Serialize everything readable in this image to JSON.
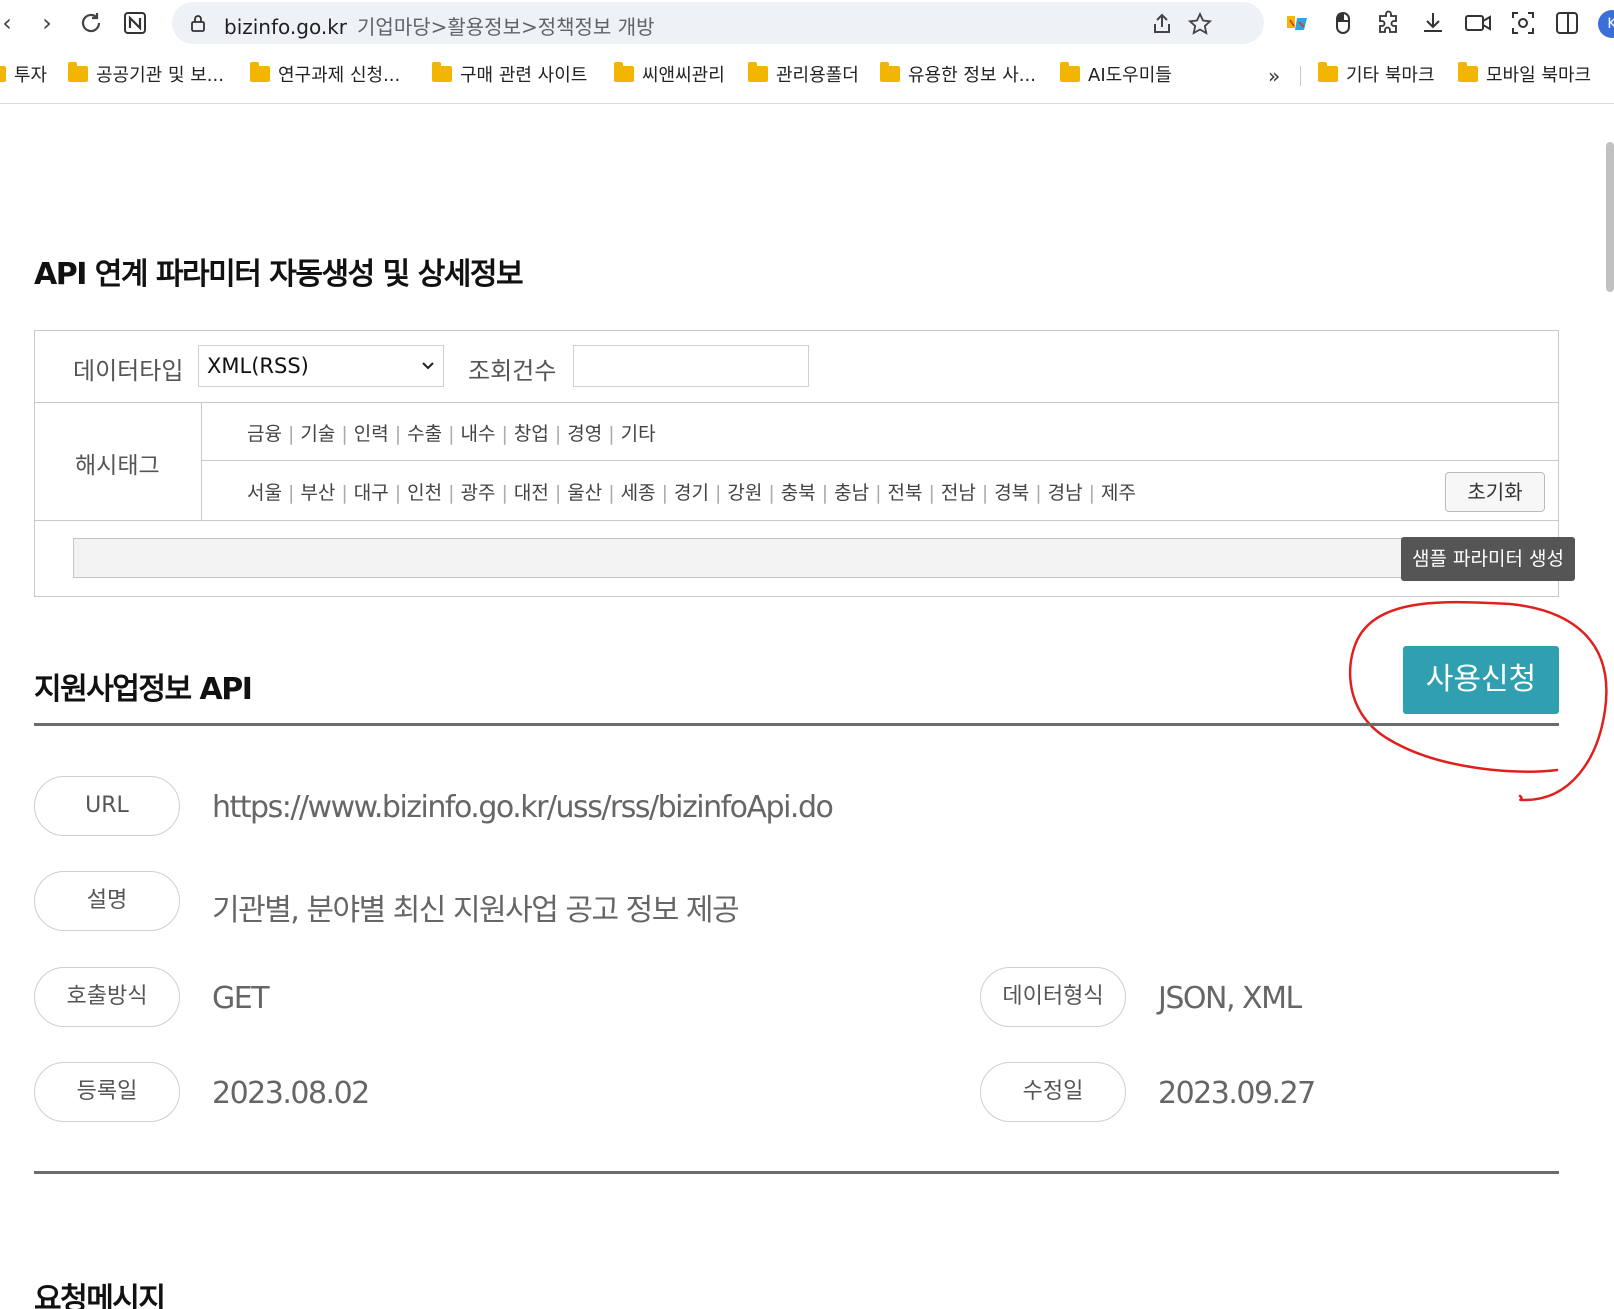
{
  "browser": {
    "url_domain": "bizinfo.go.kr",
    "url_path": "기업마당>활용정보>정책정보 개방",
    "profile_initial": "K"
  },
  "bookmarks": {
    "items": [
      {
        "label": "투자"
      },
      {
        "label": "공공기관 및 보..."
      },
      {
        "label": "연구과제 신청..."
      },
      {
        "label": "구매 관련 사이트"
      },
      {
        "label": "씨앤씨관리"
      },
      {
        "label": "관리용폴더"
      },
      {
        "label": "유용한 정보 사..."
      },
      {
        "label": "AI도우미들"
      }
    ],
    "more": "»",
    "other_bookmarks": "기타 북마크",
    "mobile_bookmarks": "모바일 북마크"
  },
  "param_section": {
    "title": "API 연계 파라미터 자동생성 및 상세정보",
    "data_type_label": "데이터타입",
    "data_type_value": "XML(RSS)",
    "count_label": "조회건수",
    "count_value": "",
    "hashtag_label": "해시태그",
    "tags_field": [
      "금융",
      "기술",
      "인력",
      "수출",
      "내수",
      "창업",
      "경영",
      "기타"
    ],
    "tags_region": [
      "서울",
      "부산",
      "대구",
      "인천",
      "광주",
      "대전",
      "울산",
      "세종",
      "경기",
      "강원",
      "충북",
      "충남",
      "전북",
      "전남",
      "경북",
      "경남",
      "제주"
    ],
    "reset_label": "초기화",
    "param_value": "",
    "generate_label": "샘플 파라미터 생성"
  },
  "api_section": {
    "title": "지원사업정보 API",
    "apply_label": "사용신청",
    "fields": {
      "url_label": "URL",
      "url_value": "https://www.bizinfo.go.kr/uss/rss/bizinfoApi.do",
      "desc_label": "설명",
      "desc_value": "기관별, 분야별 최신 지원사업 공고 정보 제공",
      "method_label": "호출방식",
      "method_value": "GET",
      "format_label": "데이터형식",
      "format_value": "JSON, XML",
      "created_label": "등록일",
      "created_value": "2023.08.02",
      "modified_label": "수정일",
      "modified_value": "2023.09.27"
    }
  },
  "request_section": {
    "title": "요청메시지"
  },
  "colors": {
    "accent": "#30a0b1",
    "annotation": "#e0201c",
    "folder": "#f2b500"
  }
}
